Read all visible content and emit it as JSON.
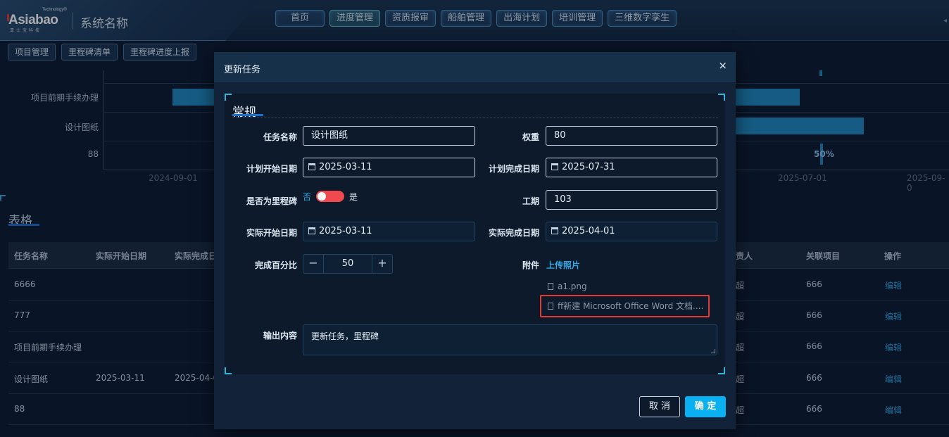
{
  "header": {
    "logo_text": "Asiabao",
    "logo_top": "Technology®",
    "logo_sub": "亚士宝科技",
    "system_name": "系统名称",
    "nav": [
      "首页",
      "进度管理",
      "资质报审",
      "船舶管理",
      "出海计划",
      "培训管理",
      "三维数字孪生"
    ]
  },
  "subnav": [
    "项目管理",
    "里程碑清单",
    "里程碑进度上报"
  ],
  "chart_data": {
    "type": "gantt",
    "categories": [
      "项目前期手续办理",
      "设计图纸",
      "88"
    ],
    "x_ticks": [
      "2024-09-01",
      "2025-07-01",
      "2025-09-0"
    ],
    "annotation": "50%"
  },
  "table": {
    "section_title": "表格",
    "columns": [
      "任务名称",
      "实际开始日期",
      "实际完成日",
      "责人",
      "关联项目",
      "操作"
    ],
    "rows": [
      {
        "name": "6666",
        "start": "",
        "end": "",
        "person": "超",
        "project": "666",
        "action": "编辑"
      },
      {
        "name": "777",
        "start": "",
        "end": "",
        "person": "超",
        "project": "666",
        "action": "编辑"
      },
      {
        "name": "项目前期手续办理",
        "start": "",
        "end": "",
        "person": "超",
        "project": "666",
        "action": "编辑"
      },
      {
        "name": "设计图纸",
        "start": "2025-03-11",
        "end": "2025-04-0",
        "person": "超",
        "project": "666",
        "action": "编辑"
      },
      {
        "name": "88",
        "start": "",
        "end": "",
        "person": "超",
        "project": "666",
        "action": "编辑"
      }
    ]
  },
  "modal": {
    "title": "更新任务",
    "close": "×",
    "section": "常规",
    "fields": {
      "task_name_label": "任务名称",
      "task_name_value": "设计图纸",
      "weight_label": "权重",
      "weight_value": "80",
      "plan_start_label": "计划开始日期",
      "plan_start_value": "2025-03-11",
      "plan_end_label": "计划完成日期",
      "plan_end_value": "2025-07-31",
      "milestone_label": "是否为里程碑",
      "milestone_off": "否",
      "milestone_on": "是",
      "duration_label": "工期",
      "duration_value": "103",
      "actual_start_label": "实际开始日期",
      "actual_start_value": "2025-03-11",
      "actual_end_label": "实际完成日期",
      "actual_end_value": "2025-04-01",
      "percent_label": "完成百分比",
      "percent_value": "50",
      "attach_label": "附件",
      "upload_label": "上传照片",
      "files": [
        "a1.png",
        "ff新建 Microsoft Office Word 文档...."
      ],
      "output_label": "输出内容",
      "output_value": "更新任务，里程碑"
    },
    "cancel": "取 消",
    "ok": "确 定"
  }
}
